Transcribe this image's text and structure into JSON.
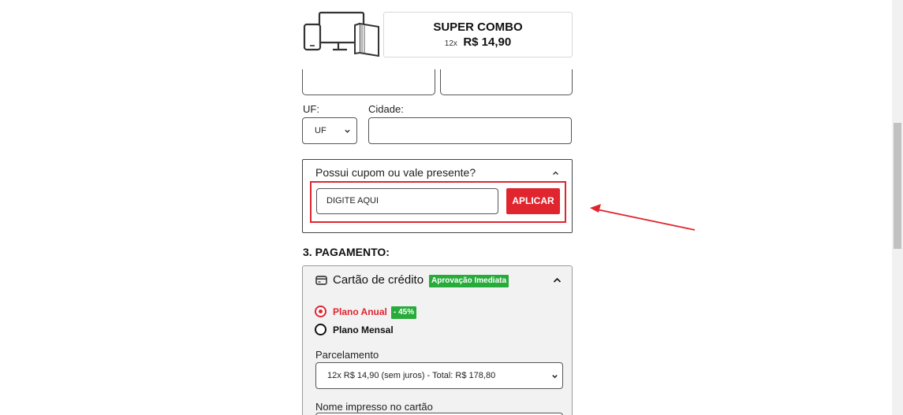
{
  "product": {
    "title": "SUPER COMBO",
    "installments": "12x",
    "price": "R$ 14,90",
    "image_icon": "devices-icon"
  },
  "address": {
    "uf_label": "UF:",
    "uf_value": "UF",
    "city_label": "Cidade:",
    "city_value": ""
  },
  "coupon": {
    "question": "Possui cupom ou vale presente?",
    "input_value": "DIGITE AQUI",
    "apply_label": "APLICAR",
    "toggle_icon": "chevron-up-icon",
    "highlight_color": "#e0252f"
  },
  "payment": {
    "section_title": "3. PAGAMENTO:",
    "method": "Cartão de crédito",
    "method_icon": "credit-card-icon",
    "method_badge": "Aprovação Imediata",
    "plans": [
      {
        "label": "Plano Anual",
        "badge": "- 45%",
        "selected": true
      },
      {
        "label": "Plano Mensal",
        "badge": "",
        "selected": false
      }
    ],
    "installments_label": "Parcelamento",
    "installments_value": "12x R$ 14,90 (sem juros) - Total: R$ 178,80",
    "card_name_label": "Nome impresso no cartão",
    "card_name_value": ""
  },
  "colors": {
    "accent_red": "#e0252f",
    "badge_green": "#27ab3a",
    "card_bg": "#f2f2f2"
  }
}
